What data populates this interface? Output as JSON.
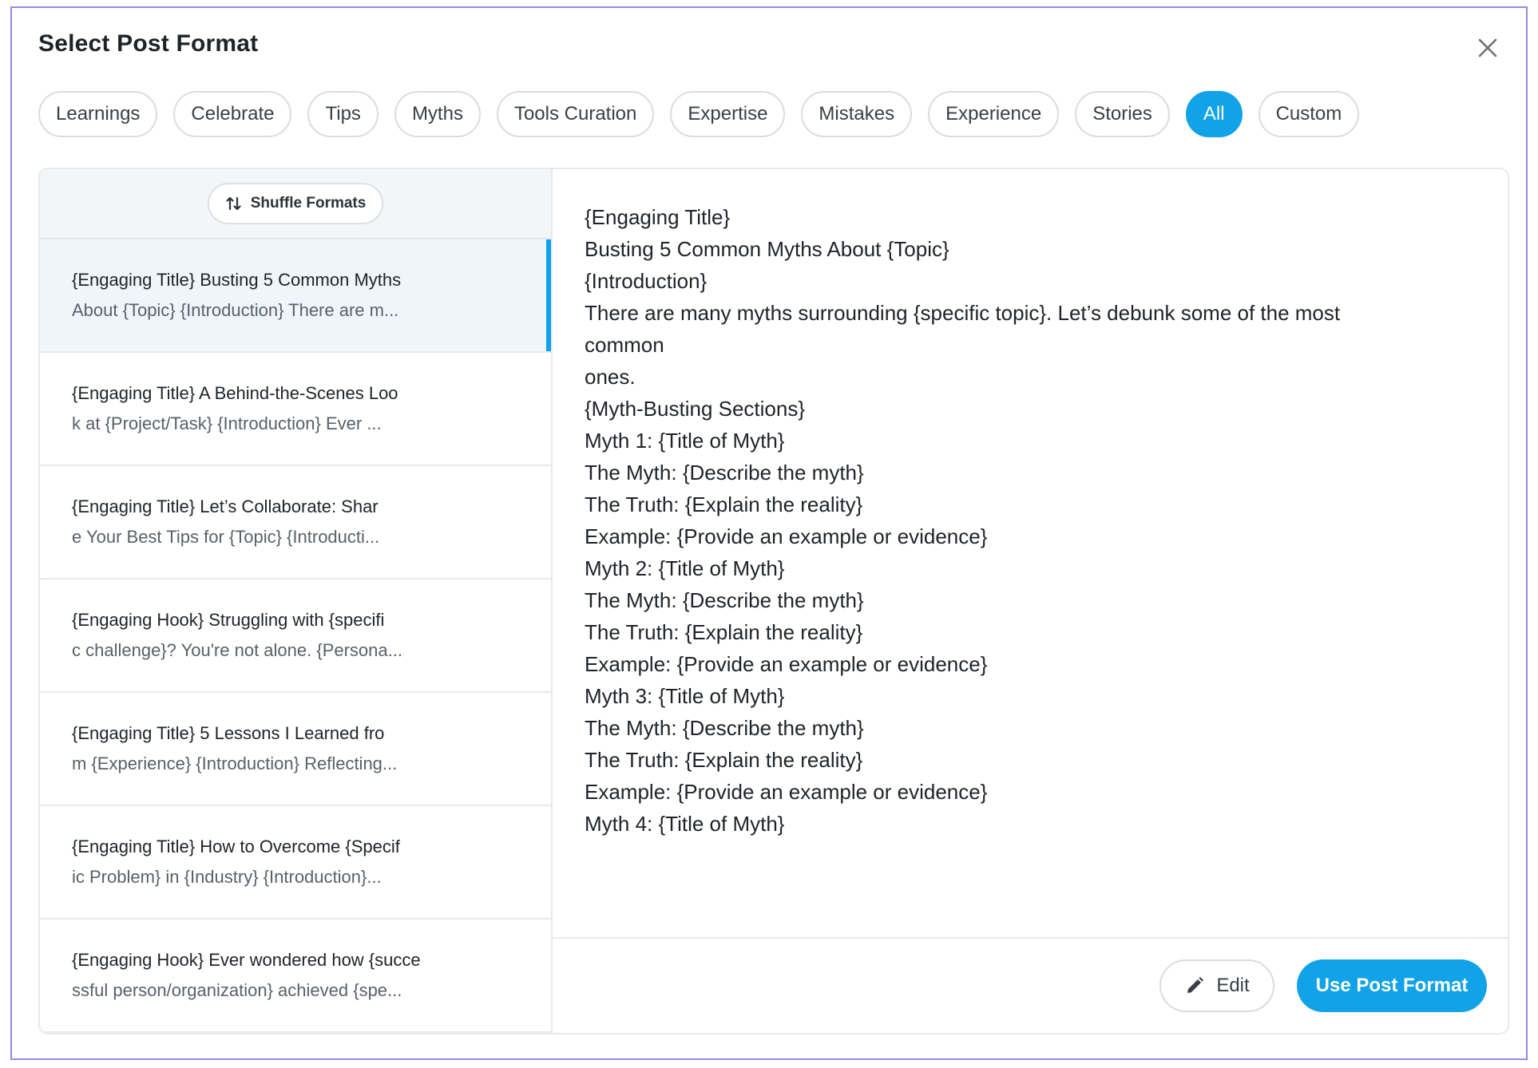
{
  "modal": {
    "title": "Select Post Format"
  },
  "chips": [
    {
      "label": "Learnings",
      "active": false
    },
    {
      "label": "Celebrate",
      "active": false
    },
    {
      "label": "Tips",
      "active": false
    },
    {
      "label": "Myths",
      "active": false
    },
    {
      "label": "Tools Curation",
      "active": false
    },
    {
      "label": "Expertise",
      "active": false
    },
    {
      "label": "Mistakes",
      "active": false
    },
    {
      "label": "Experience",
      "active": false
    },
    {
      "label": "Stories",
      "active": false
    },
    {
      "label": "All",
      "active": true
    },
    {
      "label": "Custom",
      "active": false
    }
  ],
  "sidebar": {
    "shuffle_label": "Shuffle Formats",
    "items": [
      {
        "line1": "{Engaging Title} Busting 5 Common Myths",
        "line2": "About {Topic} {Introduction} There are m...",
        "selected": true
      },
      {
        "line1": "{Engaging Title} A Behind-the-Scenes Loo",
        "line2": " k at {Project/Task} {Introduction} Ever ...",
        "selected": false
      },
      {
        "line1": "{Engaging Title} Let’s Collaborate: Shar",
        "line2": "e Your Best Tips for {Topic} {Introducti...",
        "selected": false
      },
      {
        "line1": " {Engaging Hook} Struggling with {specifi",
        "line2": "c challenge}? You're not alone. {Persona...",
        "selected": false
      },
      {
        "line1": " {Engaging Title} 5 Lessons I Learned fro",
        "line2": "m {Experience} {Introduction} Reflecting...",
        "selected": false
      },
      {
        "line1": "{Engaging Title} How to Overcome {Specif",
        "line2": "  ic Problem} in {Industry} {Introduction}...",
        "selected": false
      },
      {
        "line1": "{Engaging Hook} Ever wondered how {succe",
        "line2": "  ssful person/organization} achieved {spe...",
        "selected": false
      }
    ]
  },
  "preview": {
    "lines": [
      "{Engaging Title}",
      "Busting 5 Common Myths About {Topic}",
      "{Introduction}",
      "There are many myths surrounding {specific topic}. Let’s debunk some of the most",
      "common",
      "ones.",
      "{Myth-Busting Sections}",
      "Myth 1: {Title of Myth}",
      "The Myth: {Describe the myth}",
      "The Truth: {Explain the reality}",
      "Example: {Provide an example or evidence}",
      "Myth 2: {Title of Myth}",
      "The Myth: {Describe the myth}",
      "The Truth: {Explain the reality}",
      "Example: {Provide an example or evidence}",
      "Myth 3: {Title of Myth}",
      "The Myth: {Describe the myth}",
      "The Truth: {Explain the reality}",
      "Example: {Provide an example or evidence}",
      "Myth 4: {Title of Myth}"
    ]
  },
  "footer": {
    "edit_label": "Edit",
    "use_label": "Use Post Format"
  },
  "icons": {
    "close": "close-icon",
    "shuffle": "shuffle-arrows-icon",
    "edit": "pencil-icon"
  },
  "colors": {
    "accent": "#11a2e8",
    "modal_border": "#9b86e6",
    "selected_bg": "#eef6fc"
  }
}
